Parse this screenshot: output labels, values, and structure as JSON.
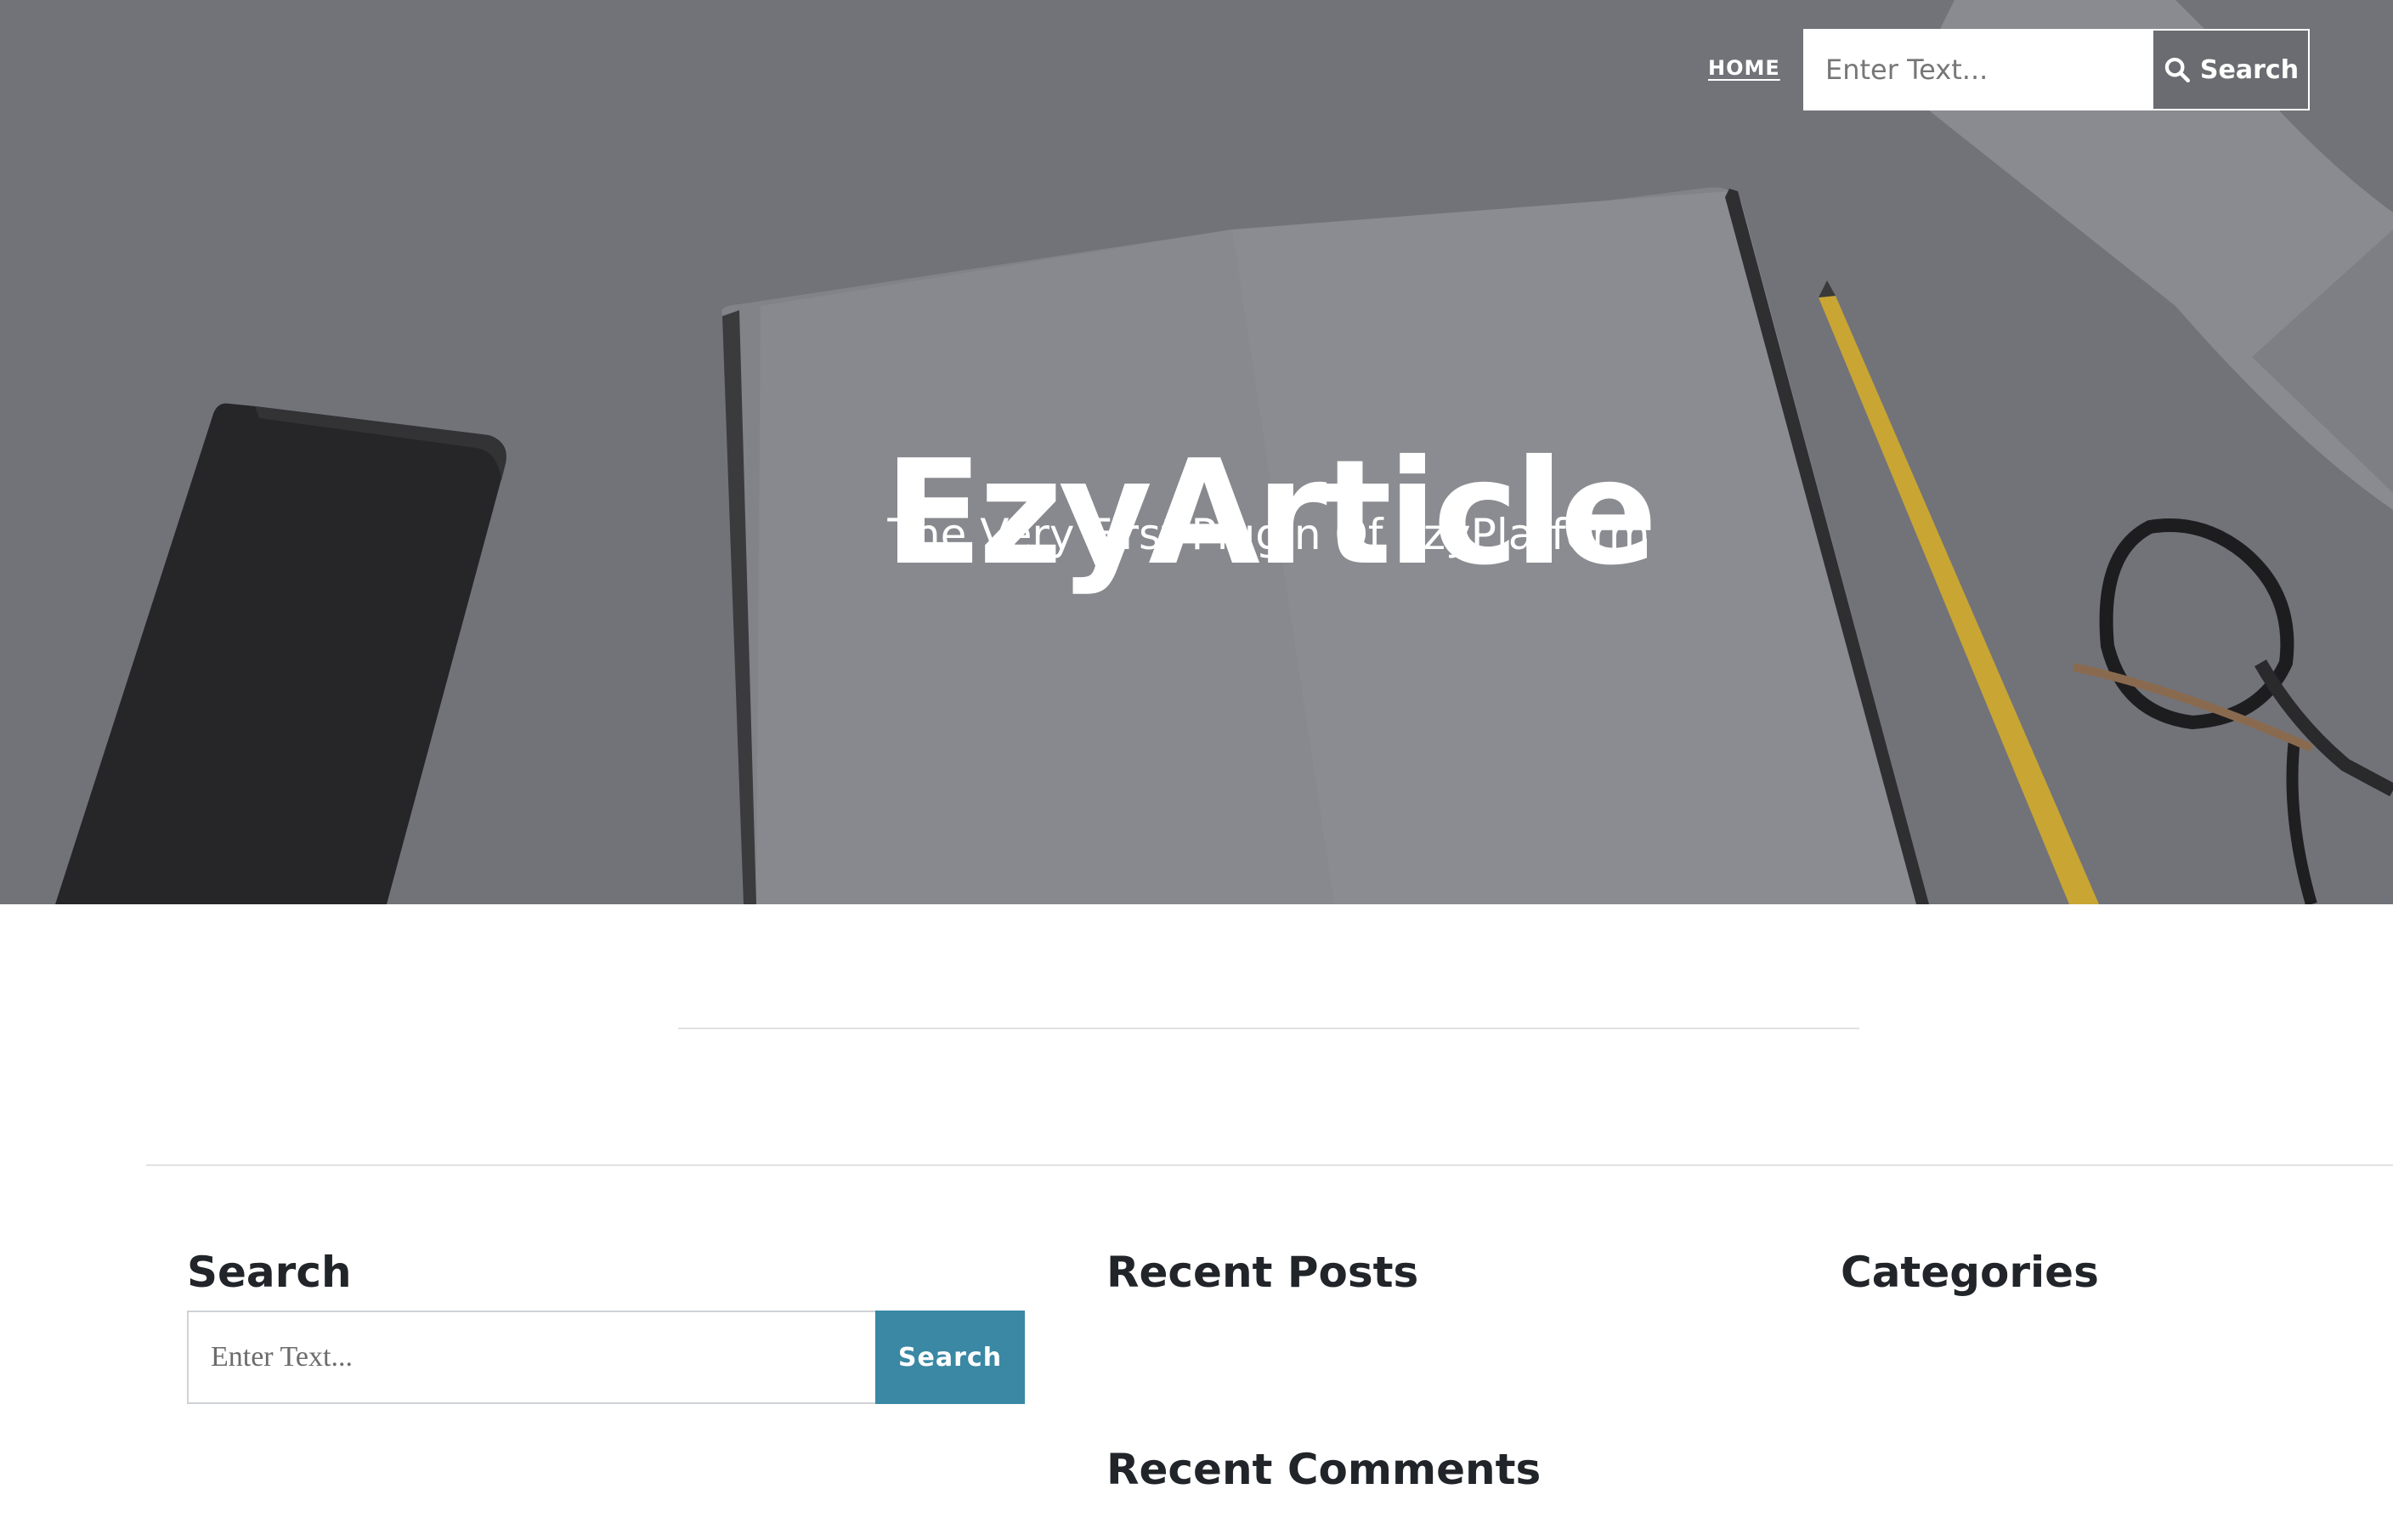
{
  "header": {
    "nav_home": "HOME",
    "search_placeholder": "Enter Text...",
    "search_button": "Search"
  },
  "hero": {
    "title": "EzyArticle",
    "tagline": "The Very First Plugin Of EzyPlatform"
  },
  "sidebar": {
    "search": {
      "title": "Search",
      "placeholder": "Enter Text...",
      "button": "Search"
    },
    "recent_posts": {
      "title": "Recent Posts"
    },
    "recent_comments": {
      "title": "Recent Comments"
    },
    "categories": {
      "title": "Categories"
    }
  },
  "colors": {
    "hero_overlay": "#6e7075",
    "accent": "#3a88a3",
    "heading": "#212529"
  },
  "icons": {
    "nav_search": "search-icon"
  }
}
